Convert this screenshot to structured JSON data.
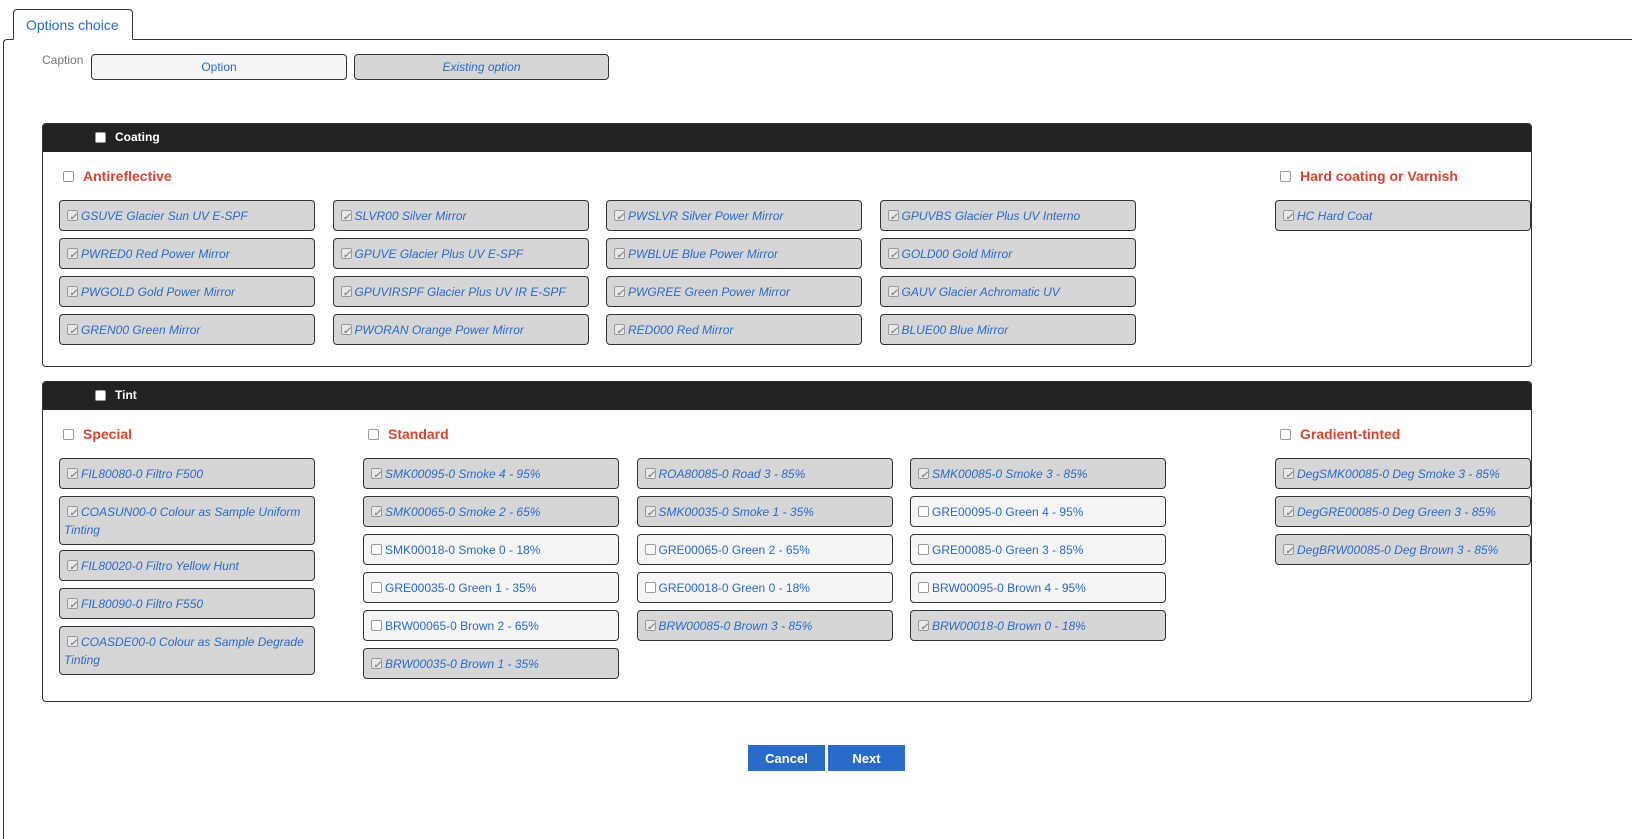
{
  "tab": {
    "label": "Options choice"
  },
  "caption": {
    "label": "Caption",
    "option_label": "Option",
    "existing_label": "Existing option"
  },
  "coating": {
    "title": "Coating",
    "checked": false,
    "antireflective": {
      "title": "Antireflective",
      "items": [
        {
          "label": "GSUVE Glacier Sun UV E-SPF",
          "checked": true
        },
        {
          "label": "SLVR00 Silver Mirror",
          "checked": true
        },
        {
          "label": "PWSLVR Silver Power Mirror",
          "checked": true
        },
        {
          "label": "GPUVBS Glacier Plus UV Interno",
          "checked": true
        },
        {
          "label": "PWRED0 Red Power Mirror",
          "checked": true
        },
        {
          "label": "GPUVE Glacier Plus UV E-SPF",
          "checked": true
        },
        {
          "label": "PWBLUE Blue Power Mirror",
          "checked": true
        },
        {
          "label": "GOLD00 Gold Mirror",
          "checked": true
        },
        {
          "label": "PWGOLD Gold Power Mirror",
          "checked": true
        },
        {
          "label": "GPUVIRSPF Glacier Plus UV IR E-SPF",
          "checked": true
        },
        {
          "label": "PWGREE Green Power Mirror",
          "checked": true
        },
        {
          "label": "GAUV Glacier Achromatic UV",
          "checked": true
        },
        {
          "label": "GREN00 Green Mirror",
          "checked": true
        },
        {
          "label": "PWORAN Orange Power Mirror",
          "checked": true
        },
        {
          "label": "RED000 Red Mirror",
          "checked": true
        },
        {
          "label": "BLUE00 Blue Mirror",
          "checked": true
        }
      ]
    },
    "hard": {
      "title": "Hard coating or Varnish",
      "items": [
        {
          "label": "HC Hard Coat",
          "checked": true
        }
      ]
    }
  },
  "tint": {
    "title": "Tint",
    "checked": false,
    "special": {
      "title": "Special",
      "items": [
        {
          "label": "FIL80080-0 Filtro F500",
          "checked": true
        },
        {
          "label": "COASUN00-0 Colour as Sample Uniform Tinting",
          "checked": true
        },
        {
          "label": "FIL80020-0 Filtro Yellow Hunt",
          "checked": true
        },
        {
          "label": "FIL80090-0 Filtro F550",
          "checked": true
        },
        {
          "label": "COASDE00-0 Colour as Sample Degrade Tinting",
          "checked": true
        }
      ]
    },
    "standard": {
      "title": "Standard",
      "items": [
        {
          "label": "SMK00095-0 Smoke 4 - 95%",
          "checked": true
        },
        {
          "label": "ROA80085-0 Road 3 - 85%",
          "checked": true
        },
        {
          "label": "SMK00085-0 Smoke 3 - 85%",
          "checked": true
        },
        {
          "label": "SMK00065-0 Smoke 2 - 65%",
          "checked": true
        },
        {
          "label": "SMK00035-0 Smoke 1 - 35%",
          "checked": true
        },
        {
          "label": "GRE00095-0 Green 4 - 95%",
          "checked": false
        },
        {
          "label": "SMK00018-0 Smoke 0 - 18%",
          "checked": false
        },
        {
          "label": "GRE00065-0 Green 2 - 65%",
          "checked": false
        },
        {
          "label": "GRE00085-0 Green 3 - 85%",
          "checked": false
        },
        {
          "label": "GRE00035-0 Green 1 - 35%",
          "checked": false
        },
        {
          "label": "GRE00018-0 Green 0 - 18%",
          "checked": false
        },
        {
          "label": "BRW00095-0 Brown 4 - 95%",
          "checked": false
        },
        {
          "label": "BRW00065-0 Brown 2 - 65%",
          "checked": false
        },
        {
          "label": "BRW00085-0 Brown 3 - 85%",
          "checked": true
        },
        {
          "label": "BRW00018-0 Brown 0 - 18%",
          "checked": true
        },
        {
          "label": "BRW00035-0 Brown 1 - 35%",
          "checked": true
        }
      ]
    },
    "gradient": {
      "title": "Gradient-tinted",
      "items": [
        {
          "label": "DegSMK00085-0 Deg Smoke 3 - 85%",
          "checked": true
        },
        {
          "label": "DegGRE00085-0 Deg Green 3 - 85%",
          "checked": true
        },
        {
          "label": "DegBRW00085-0 Deg Brown 3 - 85%",
          "checked": true
        }
      ]
    }
  },
  "actions": {
    "cancel_label": "Cancel",
    "next_label": "Next"
  },
  "colors": {
    "accent": "#2a6ac8",
    "group_title": "#d9432f",
    "panel_header": "#222222",
    "selected_bg": "#d6d6d6",
    "unselected_bg": "#f5f5f5"
  }
}
